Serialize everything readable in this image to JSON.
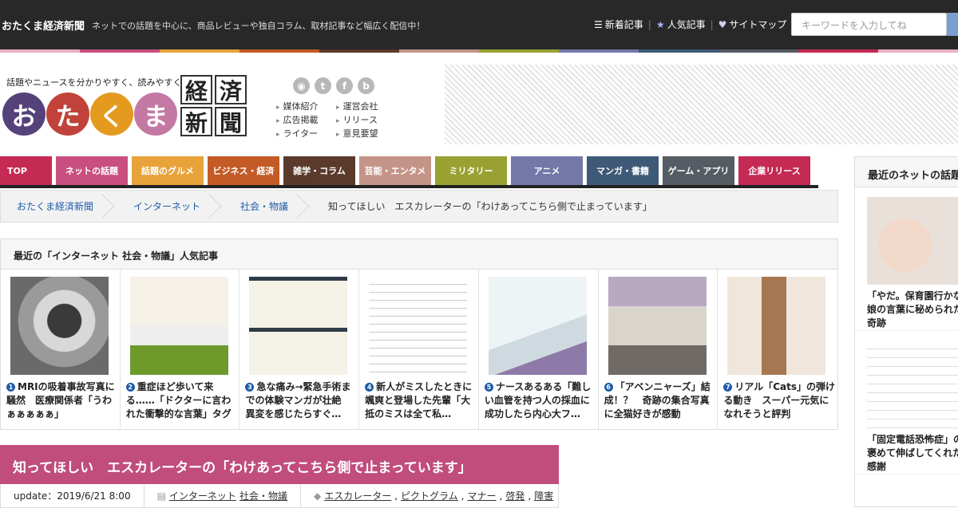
{
  "header": {
    "site_name": "おたくま経済新聞",
    "tagline": "ネットでの話題を中心に、商品レビューや独自コラム、取材記事など幅広く配信中！",
    "links": [
      {
        "label": "新着記事",
        "icon": "list-icon"
      },
      {
        "label": "人気記事",
        "icon": "star-icon"
      },
      {
        "label": "サイトマップ",
        "icon": "heart-icon"
      }
    ],
    "search_placeholder": "キーワードを入力してね"
  },
  "stripe_colors": [
    "#e8b0c4",
    "#c94f7f",
    "#e7a33a",
    "#c45a26",
    "#5a3a2b",
    "#c49488",
    "#9aa133",
    "#7378a9",
    "#3e5a77",
    "#555c63",
    "#c42a54",
    "#e8b0c4"
  ],
  "logo": {
    "tagline": "話題やニュースを分かりやすく、読みやすく。",
    "circles": [
      {
        "char": "お",
        "color": "#55427a"
      },
      {
        "char": "た",
        "color": "#c0423a"
      },
      {
        "char": "く",
        "color": "#e39a1f"
      },
      {
        "char": "ま",
        "color": "#c478a4"
      }
    ],
    "kanji": [
      "経",
      "済",
      "新",
      "聞"
    ]
  },
  "social": [
    "rss",
    "t",
    "f",
    "b"
  ],
  "mini_links": {
    "left": [
      "媒体紹介",
      "広告掲載",
      "ライター"
    ],
    "right": [
      "運営会社",
      "リリース",
      "意見要望"
    ]
  },
  "nav": [
    {
      "label": "TOP",
      "color": "#c42a54"
    },
    {
      "label": "ネットの話題",
      "color": "#c94f7f"
    },
    {
      "label": "話題のグルメ",
      "color": "#e7a33a"
    },
    {
      "label": "ビジネス・経済",
      "color": "#c45a26"
    },
    {
      "label": "雑学・コラム",
      "color": "#5a3a2b"
    },
    {
      "label": "芸能・エンタメ",
      "color": "#c49488"
    },
    {
      "label": "ミリタリー",
      "color": "#9aa133"
    },
    {
      "label": "アニメ",
      "color": "#7378a9"
    },
    {
      "label": "マンガ・書籍",
      "color": "#3e5a77"
    },
    {
      "label": "ゲーム・アプリ",
      "color": "#555c63"
    },
    {
      "label": "企業リリース",
      "color": "#c42a54"
    }
  ],
  "breadcrumb": {
    "items": [
      "おたくま経済新聞",
      "インターネット",
      "社会・物議"
    ],
    "current": "知ってほしい　エスカレーターの「わけあってこちら側で止まっています」"
  },
  "popular": {
    "heading": "最近の「インターネット 社会・物議」人気記事",
    "items": [
      {
        "num": "1",
        "title": "MRIの吸着事故写真に騒然　医療関係者「うわぁぁぁぁぁ」"
      },
      {
        "num": "2",
        "title": "重症ほど歩いて来る……「ドクターに言われた衝撃的な言葉」タグ"
      },
      {
        "num": "3",
        "title": "急な痛み→緊急手術までの体験マンガが壮絶　異変を感じたらすぐ…"
      },
      {
        "num": "4",
        "title": "新人がミスしたときに颯爽と登場した先輩「大抵のミスは全て私…"
      },
      {
        "num": "5",
        "title": "ナースあるある「難しい血管を持つ人の採血に成功したら内心大フ…"
      },
      {
        "num": "6",
        "title": "「アベンニャーズ」結成！？　奇跡の集合写真に全猫好きが感動"
      },
      {
        "num": "7",
        "title": "リアル「Cats」の弾ける動き　スーパー元気になれそうと評判"
      }
    ]
  },
  "article": {
    "title": "知ってほしい　エスカレーターの「わけあってこちら側で止まっています」",
    "update_label": "update：2019/6/21 8:00",
    "categories": [
      "インターネット",
      "社会・物議"
    ],
    "tags": [
      "エスカレーター",
      "ピクトグラム",
      "マナー",
      "啓発",
      "障害"
    ]
  },
  "sidebar": {
    "heading": "最近のネットの話題",
    "items": [
      {
        "title_lines": [
          "「やだ。保育園行かない",
          "娘の言葉に秘められた与",
          "奇跡"
        ]
      },
      {
        "title_lines": [
          "「固定電話恐怖症」の新",
          "褒めて伸ばしてくれた上",
          "感謝"
        ]
      }
    ]
  }
}
